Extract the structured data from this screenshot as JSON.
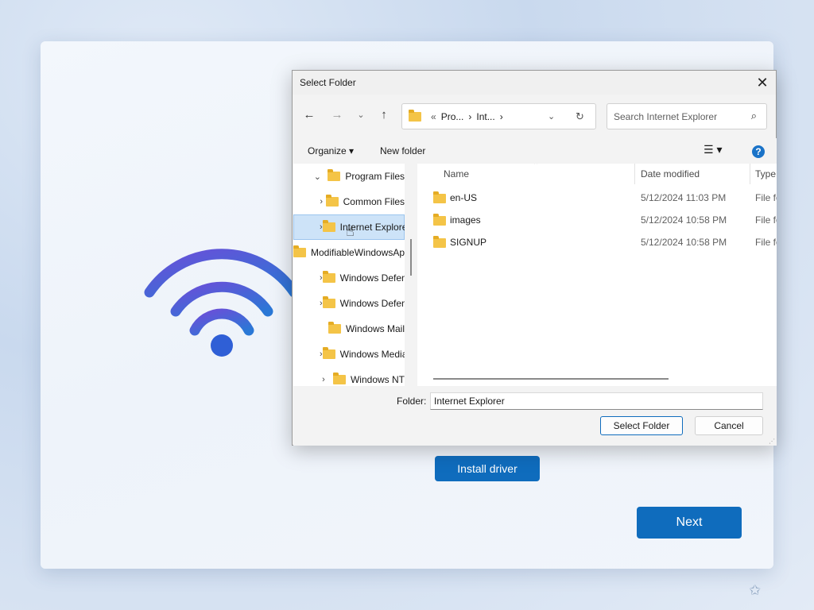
{
  "oobe": {
    "install_button": "Install driver",
    "next_button": "Next"
  },
  "dialog": {
    "title": "Select Folder",
    "close_glyph": "✕",
    "address": {
      "prefix": "«",
      "crumbs": [
        "Pro...",
        "Int..."
      ],
      "separator": "›"
    },
    "search": {
      "placeholder": "Search Internet Explorer"
    },
    "toolbar": {
      "organize": "Organize",
      "new_folder": "New folder"
    },
    "tree": {
      "items": [
        {
          "label": "Program Files",
          "expanded": true,
          "has_children": true,
          "level": 0
        },
        {
          "label": "Common Files",
          "has_children": true,
          "level": 1
        },
        {
          "label": "Internet Explorer",
          "has_children": true,
          "level": 1,
          "selected": true
        },
        {
          "label": "ModifiableWindowsApps",
          "has_children": false,
          "level": 1
        },
        {
          "label": "Windows Defender",
          "has_children": true,
          "level": 1
        },
        {
          "label": "Windows Defender Advanced Threat Protection",
          "has_children": true,
          "level": 1
        },
        {
          "label": "Windows Mail",
          "has_children": false,
          "level": 1
        },
        {
          "label": "Windows Media Player",
          "has_children": true,
          "level": 1
        },
        {
          "label": "Windows NT",
          "has_children": true,
          "level": 1
        }
      ]
    },
    "columns": {
      "name": "Name",
      "date": "Date modified",
      "type": "Type"
    },
    "files": [
      {
        "name": "en-US",
        "date": "5/12/2024 11:03 PM",
        "type": "File folder"
      },
      {
        "name": "images",
        "date": "5/12/2024 10:58 PM",
        "type": "File folder"
      },
      {
        "name": "SIGNUP",
        "date": "5/12/2024 10:58 PM",
        "type": "File folder"
      }
    ],
    "folder_label": "Folder:",
    "folder_value": "Internet Explorer",
    "select_button": "Select Folder",
    "cancel_button": "Cancel"
  },
  "colors": {
    "accent": "#0f6cbd",
    "folder": "#f4c447",
    "selection": "#cde3f8",
    "wifi_gradient": [
      "#6a4fd8",
      "#2a78d6"
    ]
  },
  "icons": [
    "wifi-icon",
    "back-arrow-icon",
    "forward-arrow-icon",
    "recent-locations-icon",
    "up-arrow-icon",
    "refresh-icon",
    "search-icon",
    "view-options-icon",
    "help-icon",
    "folder-icon",
    "close-icon",
    "hand-cursor-icon",
    "accessibility-icon"
  ]
}
